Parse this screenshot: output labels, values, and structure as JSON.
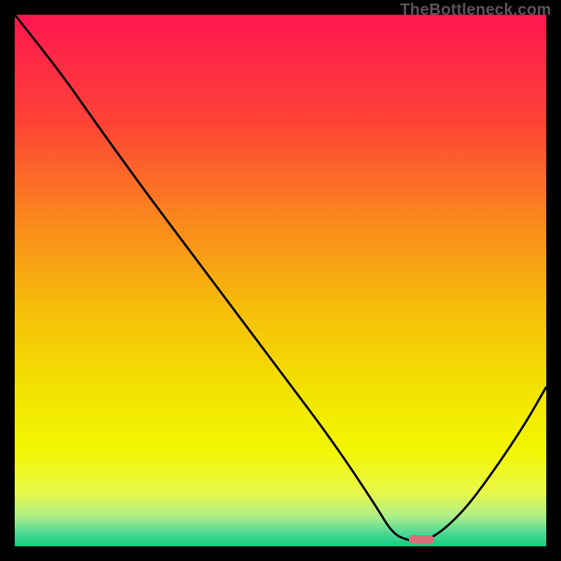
{
  "attribution": "TheBottleneck.com",
  "chart_data": {
    "type": "line",
    "title": "",
    "xlabel": "",
    "ylabel": "",
    "xlim": [
      0,
      100
    ],
    "ylim": [
      0,
      100
    ],
    "series": [
      {
        "name": "bottleneck-curve",
        "x": [
          0,
          8,
          15,
          24,
          33,
          42,
          51,
          60,
          68,
          71,
          74,
          78,
          84,
          90,
          96,
          100
        ],
        "y": [
          100,
          90,
          80,
          67.5,
          55.5,
          43.5,
          31.5,
          19.5,
          7.5,
          2.5,
          1.0,
          1.0,
          6,
          14,
          23,
          30
        ]
      }
    ],
    "gradient_stops": [
      {
        "pos": 0.0,
        "color": "#ff1650"
      },
      {
        "pos": 0.2,
        "color": "#fe4236"
      },
      {
        "pos": 0.4,
        "color": "#fa8c1b"
      },
      {
        "pos": 0.55,
        "color": "#f6bd0a"
      },
      {
        "pos": 0.72,
        "color": "#f2e600"
      },
      {
        "pos": 0.82,
        "color": "#f2f603"
      },
      {
        "pos": 0.9,
        "color": "#e9f84b"
      },
      {
        "pos": 0.945,
        "color": "#aaee89"
      },
      {
        "pos": 0.975,
        "color": "#4dd994"
      },
      {
        "pos": 1.0,
        "color": "#13cd7f"
      }
    ],
    "marker": {
      "x": 76.5,
      "y": 1.3
    }
  }
}
